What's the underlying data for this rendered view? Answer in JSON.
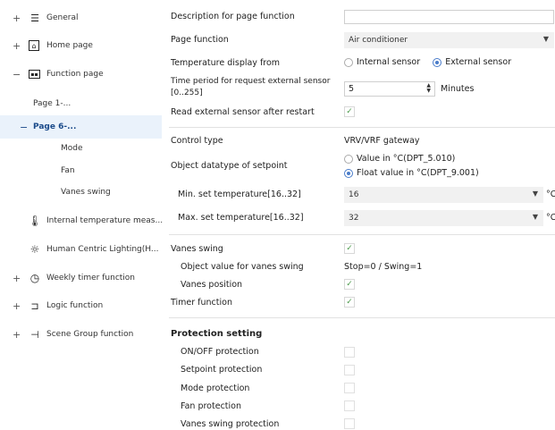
{
  "sidebar": {
    "items": [
      {
        "key": "general",
        "sign": "+",
        "label": "General",
        "icon": "sliders-icon"
      },
      {
        "key": "home",
        "sign": "+",
        "label": "Home page",
        "icon": "home-icon"
      },
      {
        "key": "function",
        "sign": "−",
        "label": "Function page",
        "icon": "panel-icon"
      },
      {
        "key": "page1",
        "sign": "",
        "label": "Page 1-..."
      },
      {
        "key": "page6",
        "sign": "−",
        "label": "Page 6-..."
      },
      {
        "key": "mode",
        "sign": "",
        "label": "Mode"
      },
      {
        "key": "fan",
        "sign": "",
        "label": "Fan"
      },
      {
        "key": "vanes",
        "sign": "",
        "label": "Vanes swing"
      },
      {
        "key": "temp",
        "sign": "",
        "label": "Internal temperature meas...",
        "icon": "thermometer-icon"
      },
      {
        "key": "hcl",
        "sign": "",
        "label": "Human Centric Lighting(H...",
        "icon": "sun-icon"
      },
      {
        "key": "weekly",
        "sign": "+",
        "label": "Weekly timer function",
        "icon": "clock-icon"
      },
      {
        "key": "logic",
        "sign": "+",
        "label": "Logic function",
        "icon": "logic-icon"
      },
      {
        "key": "scene",
        "sign": "+",
        "label": "Scene Group function",
        "icon": "scene-icon"
      }
    ]
  },
  "form": {
    "description_label": "Description for page function",
    "description_value": "",
    "page_function_label": "Page function",
    "page_function_value": "Air conditioner",
    "temp_display_label": "Temperature display  from",
    "temp_internal": "Internal sensor",
    "temp_external": "External sensor",
    "time_period_label_1": "Time period for request external sensor",
    "time_period_label_2": "[0..255]",
    "time_period_value": "5",
    "time_period_unit": "Minutes",
    "read_sensor_label": "Read external sensor after restart",
    "control_type_label": "Control type",
    "control_type_value": "VRV/VRF gateway",
    "datatype_label": "Object datatype of setpoint",
    "datatype_opt1": "Value in °C(DPT_5.010)",
    "datatype_opt2": "Float value in °C(DPT_9.001)",
    "min_label": "Min. set temperature[16..32]",
    "min_value": "16",
    "max_label": "Max. set temperature[16..32]",
    "max_value": "32",
    "unit_c": "°C",
    "vanes_label": "Vanes swing",
    "vanes_obj_label": "Object value for vanes swing",
    "vanes_obj_value": "Stop=0 / Swing=1",
    "vanes_pos_label": "Vanes position",
    "timer_label": "Timer function",
    "protection_heading": "Protection setting",
    "onoff_label": "ON/OFF protection",
    "setpoint_label": "Setpoint protection",
    "mode_label": "Mode protection",
    "fan_label": "Fan protection",
    "vanes_swing_prot_label": "Vanes swing protection",
    "check_mark": "✓"
  },
  "colors": {
    "accent": "#4a7cc9",
    "check": "#4a9a4a",
    "active_bg": "#eaf2fb"
  }
}
